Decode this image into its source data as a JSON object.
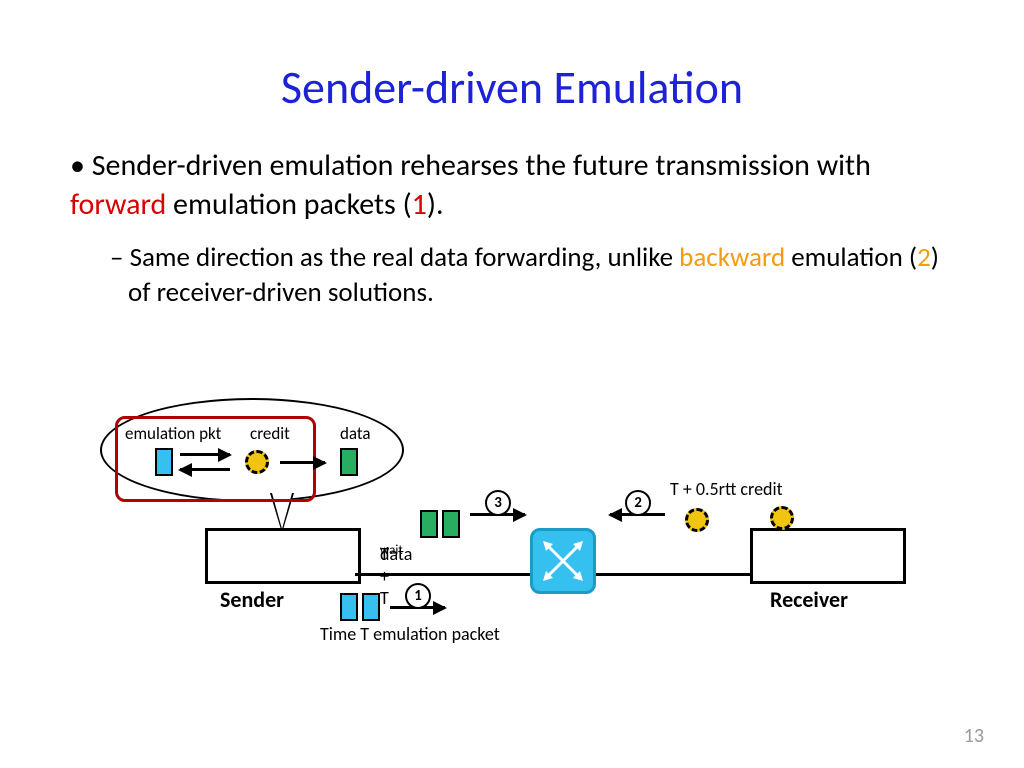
{
  "title": "Sender-driven Emulation",
  "bullet1_a": "Sender-driven emulation rehearses the future transmission with ",
  "bullet1_forward": "forward",
  "bullet1_b": " emulation packets (",
  "bullet1_one": "1",
  "bullet1_c": ").",
  "bullet2_a": "Same direction as the real data forwarding, unlike ",
  "bullet2_backward": "backward",
  "bullet2_b": " emulation (",
  "bullet2_two": "2",
  "bullet2_c": ") of receiver-driven solutions.",
  "legend": {
    "emu": "emulation pkt",
    "credit": "credit",
    "data": "data"
  },
  "diagram": {
    "sender": "Sender",
    "receiver": "Receiver",
    "credit_time": "T + 0.5rtt credit",
    "data_time_a": "T + T",
    "data_time_sub": "wait",
    "data_time_b": " data",
    "emu_time": "Time T emulation packet",
    "step1": "1",
    "step2": "2",
    "step3": "3"
  },
  "page_number": "13"
}
